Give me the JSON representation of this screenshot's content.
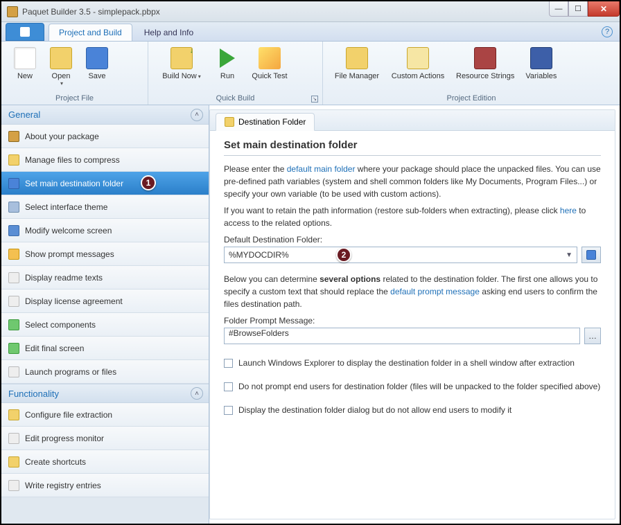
{
  "window": {
    "title": "Paquet Builder 3.5 - simplepack.pbpx"
  },
  "tabs": {
    "active": "Project and Build",
    "other": "Help and Info"
  },
  "ribbon": {
    "groups": {
      "project_file": {
        "title": "Project File",
        "items": {
          "new": "New",
          "open": "Open",
          "save": "Save"
        }
      },
      "quick_build": {
        "title": "Quick Build",
        "items": {
          "build": "Build Now",
          "run": "Run",
          "test": "Quick Test"
        }
      },
      "project_edition": {
        "title": "Project Edition",
        "items": {
          "fm": "File Manager",
          "ca": "Custom Actions",
          "rs": "Resource Strings",
          "var": "Variables"
        }
      }
    }
  },
  "sidebar": {
    "general": {
      "title": "General",
      "items": [
        "About your package",
        "Manage files to compress",
        "Set main destination folder",
        "Select interface theme",
        "Modify welcome screen",
        "Show prompt messages",
        "Display readme texts",
        "Display license agreement",
        "Select components",
        "Edit final screen",
        "Launch programs or files"
      ]
    },
    "functionality": {
      "title": "Functionality",
      "items": [
        "Configure file extraction",
        "Edit progress monitor",
        "Create shortcuts",
        "Write registry entries"
      ]
    }
  },
  "content": {
    "tab_label": "Destination Folder",
    "heading": "Set main destination folder",
    "intro_prefix": "Please enter the ",
    "intro_link1": "default main folder",
    "intro_rest1": " where your package should place the unpacked files. You can use pre-defined path variables (system and shell common folders like My Documents, Program Files...) or specify your own variable (to be used with custom actions).",
    "intro2_prefix": "If you want to retain the path information (restore sub-folders when extracting), please click ",
    "intro2_link": "here",
    "intro2_rest": " to access to the related options.",
    "dest_label": "Default Destination Folder:",
    "dest_value": "%MYDOCDIR%",
    "below_prefix": "Below you can determine ",
    "below_strong": "several options",
    "below_mid": " related to the destination folder. The first one allows you to specify a custom text that should replace the ",
    "below_link": "default prompt message",
    "below_rest": " asking end users to confirm the files destination path.",
    "prompt_label": "Folder Prompt Message:",
    "prompt_value": "#BrowseFolders",
    "chk1": "Launch Windows Explorer to display the destination folder in a shell window after extraction",
    "chk2": "Do not prompt end users for destination folder (files will be unpacked to the folder specified above)",
    "chk3": "Display the destination folder dialog but do not allow end users to modify it"
  },
  "annotations": {
    "step1": "1",
    "step2": "2"
  }
}
